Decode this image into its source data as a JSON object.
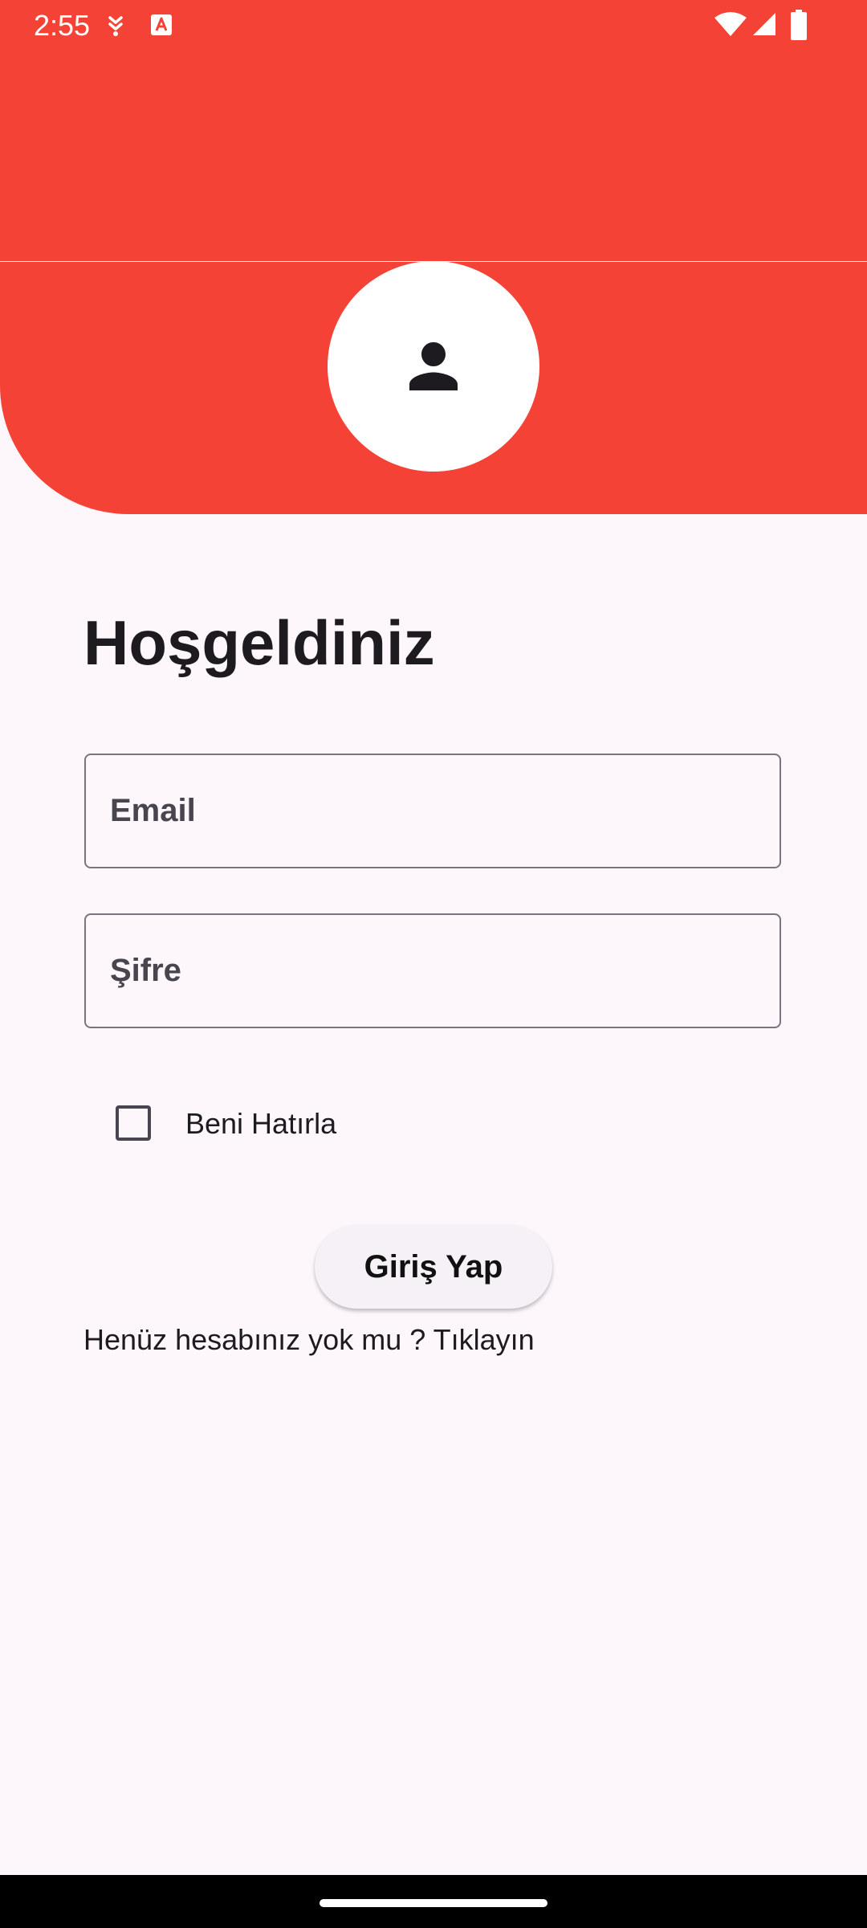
{
  "status_bar": {
    "time": "2:55",
    "icons": [
      "download-indicator-icon",
      "app-notification-icon",
      "wifi-icon",
      "signal-icon",
      "battery-icon"
    ]
  },
  "colors": {
    "header": "#f44336",
    "background": "#fdf7fc",
    "text": "#1d1b20",
    "outline": "#79747e"
  },
  "avatar": {
    "icon": "person-icon"
  },
  "login": {
    "title": "Hoşgeldiniz",
    "email_placeholder": "Email",
    "password_placeholder": "Şifre",
    "remember_label": "Beni Hatırla",
    "remember_checked": false,
    "submit_label": "Giriş Yap",
    "signup_text": "Henüz hesabınız yok mu ? Tıklayın"
  }
}
